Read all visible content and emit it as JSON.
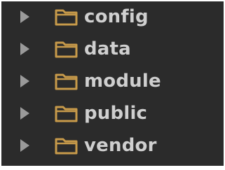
{
  "tree": {
    "items": [
      {
        "label": "config",
        "icon": "folder-icon",
        "expanded": false
      },
      {
        "label": "data",
        "icon": "folder-icon",
        "expanded": false
      },
      {
        "label": "module",
        "icon": "folder-icon",
        "expanded": false
      },
      {
        "label": "public",
        "icon": "folder-icon",
        "expanded": false
      },
      {
        "label": "vendor",
        "icon": "folder-icon",
        "expanded": false
      }
    ]
  },
  "colors": {
    "background": "#2b2b2b",
    "folder": "#c79a4a",
    "arrow": "#9a9a9a",
    "text": "#cfcfcf"
  }
}
